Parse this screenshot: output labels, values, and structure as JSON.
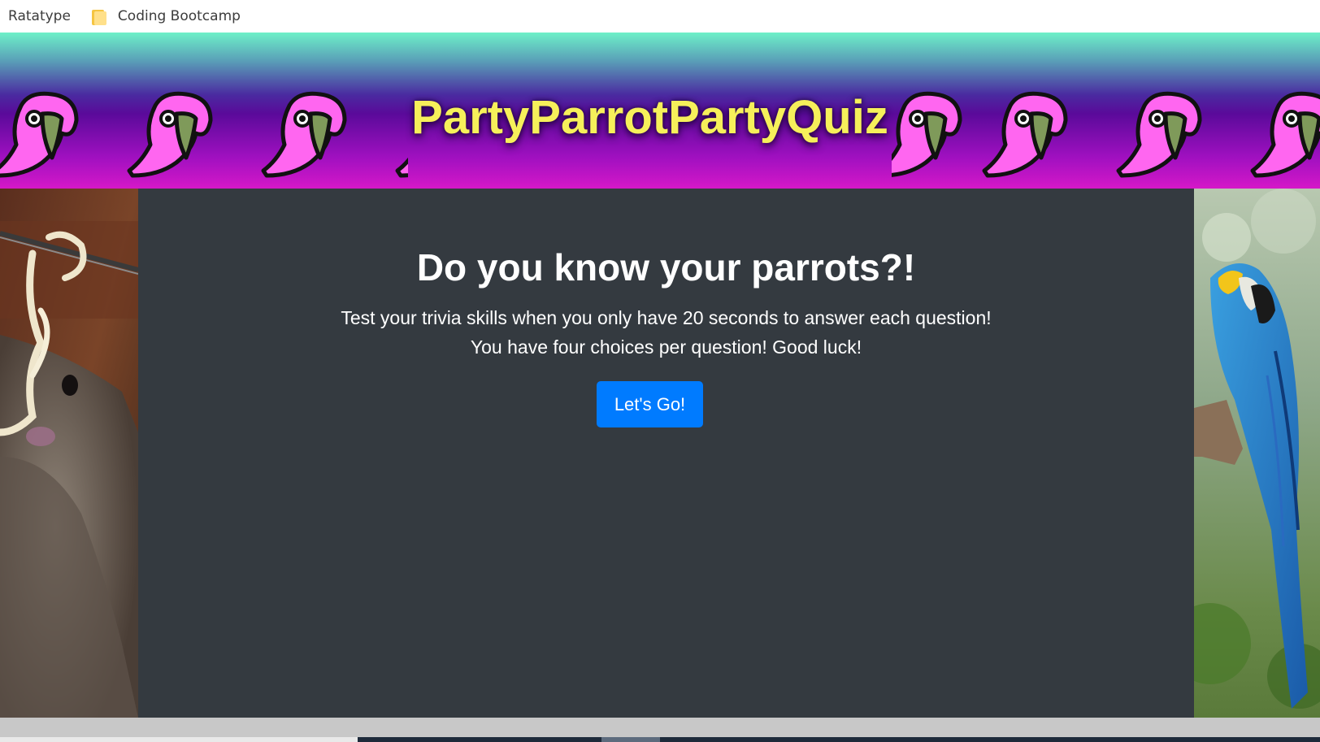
{
  "bookmarks": [
    {
      "label": "Ratatype",
      "icon": "none"
    },
    {
      "label": "Coding Bootcamp",
      "icon": "folder-icon"
    }
  ],
  "header": {
    "title": "PartyParrotPartyQuiz",
    "title_color": "#f6f05a",
    "parrot_color": "#ff66f0",
    "beak_color": "#7f9a5a"
  },
  "hero": {
    "heading": "Do you know your parrots?!",
    "line1": "Test your trivia skills when you only have 20 seconds to answer each question!",
    "line2": "You have four choices per question! Good luck!",
    "button_label": "Let's Go!",
    "button_color": "#007bff",
    "panel_color": "#343a40"
  },
  "side_images": {
    "left": "bird-eating-noodle-photo",
    "right": "blue-macaw-photo"
  }
}
